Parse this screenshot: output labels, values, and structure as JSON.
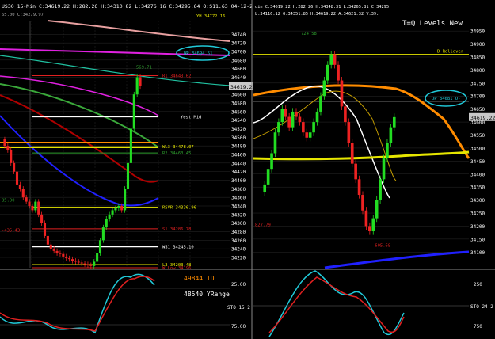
{
  "colors": {
    "background": "#000000",
    "candle_up": "#22dd22",
    "candle_down": "#ee2222",
    "axis_text": "#ffffff",
    "grid": "#2a2a2a",
    "annotation_cyan": "#21c9d8",
    "level_yellow": "#e6e600",
    "level_red": "#e02020",
    "level_white": "#ffffff",
    "ma_magenta": "#e020e0",
    "ma_blue": "#2020ff",
    "ma_orange": "#ff8c00",
    "ma_green": "#2e9e2e",
    "price_marker_bg": "#c8c8c8"
  },
  "left_chart": {
    "header": "US30  15-Min  C:34619.22  H:282.26  H:34310.82  L:34276.16  C:34295.64  O:S11.63  04-12-22  1:43",
    "sub_header": "65.00  C:34279.97",
    "current_price": "34619.22",
    "top_right_label": "YH  34772.16",
    "callout": "WP  34694.51",
    "peak_label": "569.71",
    "overlay_text": {
      "td": "49844 TD",
      "yrange": "48540 YRange"
    },
    "levels": [
      {
        "name": "R1",
        "label": "R1  34643.62",
        "price": 34643.62,
        "color": "#e02020"
      },
      {
        "name": "Yest Mid",
        "label": "Yest Mid",
        "price": 34548,
        "color": "#ffffff"
      },
      {
        "name": "WL3",
        "label": "WL3  34478.07",
        "price": 34478.07,
        "color": "#e6e600"
      },
      {
        "name": "R2",
        "label": "R2  34463.45",
        "price": 34463.45,
        "color": "#2e9e2e"
      },
      {
        "name": "RSVR",
        "label": "RSVR  34336.96",
        "price": 34336.96,
        "color": "#e6e600"
      },
      {
        "name": "S1",
        "label": "S1  34286.78",
        "price": 34286.78,
        "color": "#e02020"
      },
      {
        "name": "WS1",
        "label": "WS1  34245.10",
        "price": 34245.1,
        "color": "#ffffff"
      },
      {
        "name": "L3",
        "label": "L3  34203.48",
        "price": 34203.48,
        "color": "#e6e600"
      },
      {
        "name": "WLow",
        "label": "W Low  34196",
        "price": 34196,
        "color": "#e02020"
      }
    ],
    "side_labels": [
      {
        "text": "85.00",
        "price": 34350
      },
      {
        "text": "-435.43",
        "price": 34280
      }
    ],
    "stochastic": {
      "labels": [
        "25.00",
        "STO 15.2",
        "75.00"
      ]
    }
  },
  "right_chart": {
    "header": "din  C:34619.22  H:282.26  H:34348.31  L:34265.81  C:34295.64  O:5.311  C:34205.04  04-12-22  1:01:43",
    "header_right": "L:34116.12  O:34351.85  H:34619.22  A:34621.32  V:39.",
    "title": "T=Q Levels New",
    "current_price": "34619.22",
    "callout": "OP  34681  O-",
    "high_label": "724.58",
    "low_label": "-605.69",
    "left_label": "827.79",
    "rollover_label": "D Rollover",
    "stochastic": {
      "labels": [
        "250",
        "STO 24.2",
        "750"
      ]
    }
  },
  "chart_data": [
    {
      "type": "candlestick",
      "title": "US30 15-Min",
      "ylim": [
        34196,
        34772
      ],
      "y_ticks": [
        34740,
        34720,
        34700,
        34680,
        34660,
        34640,
        34620,
        34600,
        34580,
        34560,
        34540,
        34520,
        34500,
        34480,
        34460,
        34440,
        34420,
        34400,
        34380,
        34360,
        34340,
        34320,
        34300,
        34280,
        34260,
        34240,
        34220
      ],
      "close": [
        34480,
        34470,
        34440,
        34420,
        34390,
        34380,
        34360,
        34350,
        34340,
        34330,
        34350,
        34320,
        34300,
        34270,
        34250,
        34240,
        34235,
        34230,
        34228,
        34222,
        34218,
        34216,
        34212,
        34210,
        34208,
        34206,
        34204,
        34202,
        34200,
        34210,
        34230,
        34260,
        34290,
        34310,
        34320,
        34330,
        34335,
        34340,
        34330,
        34380,
        34440,
        34520,
        34600,
        34640,
        34619
      ]
    },
    {
      "type": "candlestick",
      "title": "T=Q Levels New",
      "ylim": [
        34040,
        34990
      ],
      "y_ticks": [
        34950,
        34900,
        34850,
        34800,
        34750,
        34700,
        34650,
        34600,
        34550,
        34500,
        34450,
        34400,
        34350,
        34300,
        34250,
        34200,
        34150,
        34100
      ],
      "close": [
        34360,
        34420,
        34480,
        34560,
        34600,
        34650,
        34620,
        34580,
        34640,
        34620,
        34600,
        34560,
        34540,
        34560,
        34600,
        34640,
        34700,
        34760,
        34820,
        34860,
        34820,
        34760,
        34660,
        34600,
        34520,
        34440,
        34380,
        34320,
        34260,
        34200,
        34180,
        34230,
        34300,
        34380,
        34460,
        34520,
        34580,
        34619
      ]
    }
  ]
}
